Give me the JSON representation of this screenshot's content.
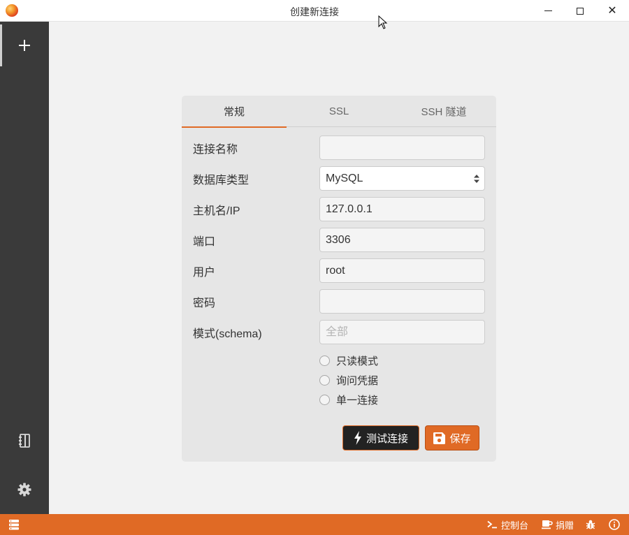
{
  "window": {
    "title": "创建新连接"
  },
  "sidebar": {
    "add_icon": "plus-icon",
    "notebook_icon": "notebook-icon",
    "settings_icon": "gear-icon"
  },
  "tabs": [
    {
      "label": "常规",
      "active": true
    },
    {
      "label": "SSL",
      "active": false
    },
    {
      "label": "SSH 隧道",
      "active": false
    }
  ],
  "form": {
    "connection_name": {
      "label": "连接名称",
      "value": ""
    },
    "db_type": {
      "label": "数据库类型",
      "value": "MySQL"
    },
    "host": {
      "label": "主机名/IP",
      "value": "127.0.0.1"
    },
    "port": {
      "label": "端口",
      "value": "3306"
    },
    "user": {
      "label": "用户",
      "value": "root"
    },
    "password": {
      "label": "密码",
      "value": ""
    },
    "schema": {
      "label": "模式(schema)",
      "placeholder": "全部"
    },
    "options": [
      {
        "label": "只读模式",
        "checked": false
      },
      {
        "label": "询问凭据",
        "checked": false
      },
      {
        "label": "单一连接",
        "checked": false
      }
    ]
  },
  "buttons": {
    "test": "测试连接",
    "save": "保存"
  },
  "statusbar": {
    "console": "控制台",
    "donate": "捐赠"
  },
  "colors": {
    "accent": "#e06a25",
    "sidebar": "#3a3a3a",
    "card": "#e6e6e6"
  }
}
